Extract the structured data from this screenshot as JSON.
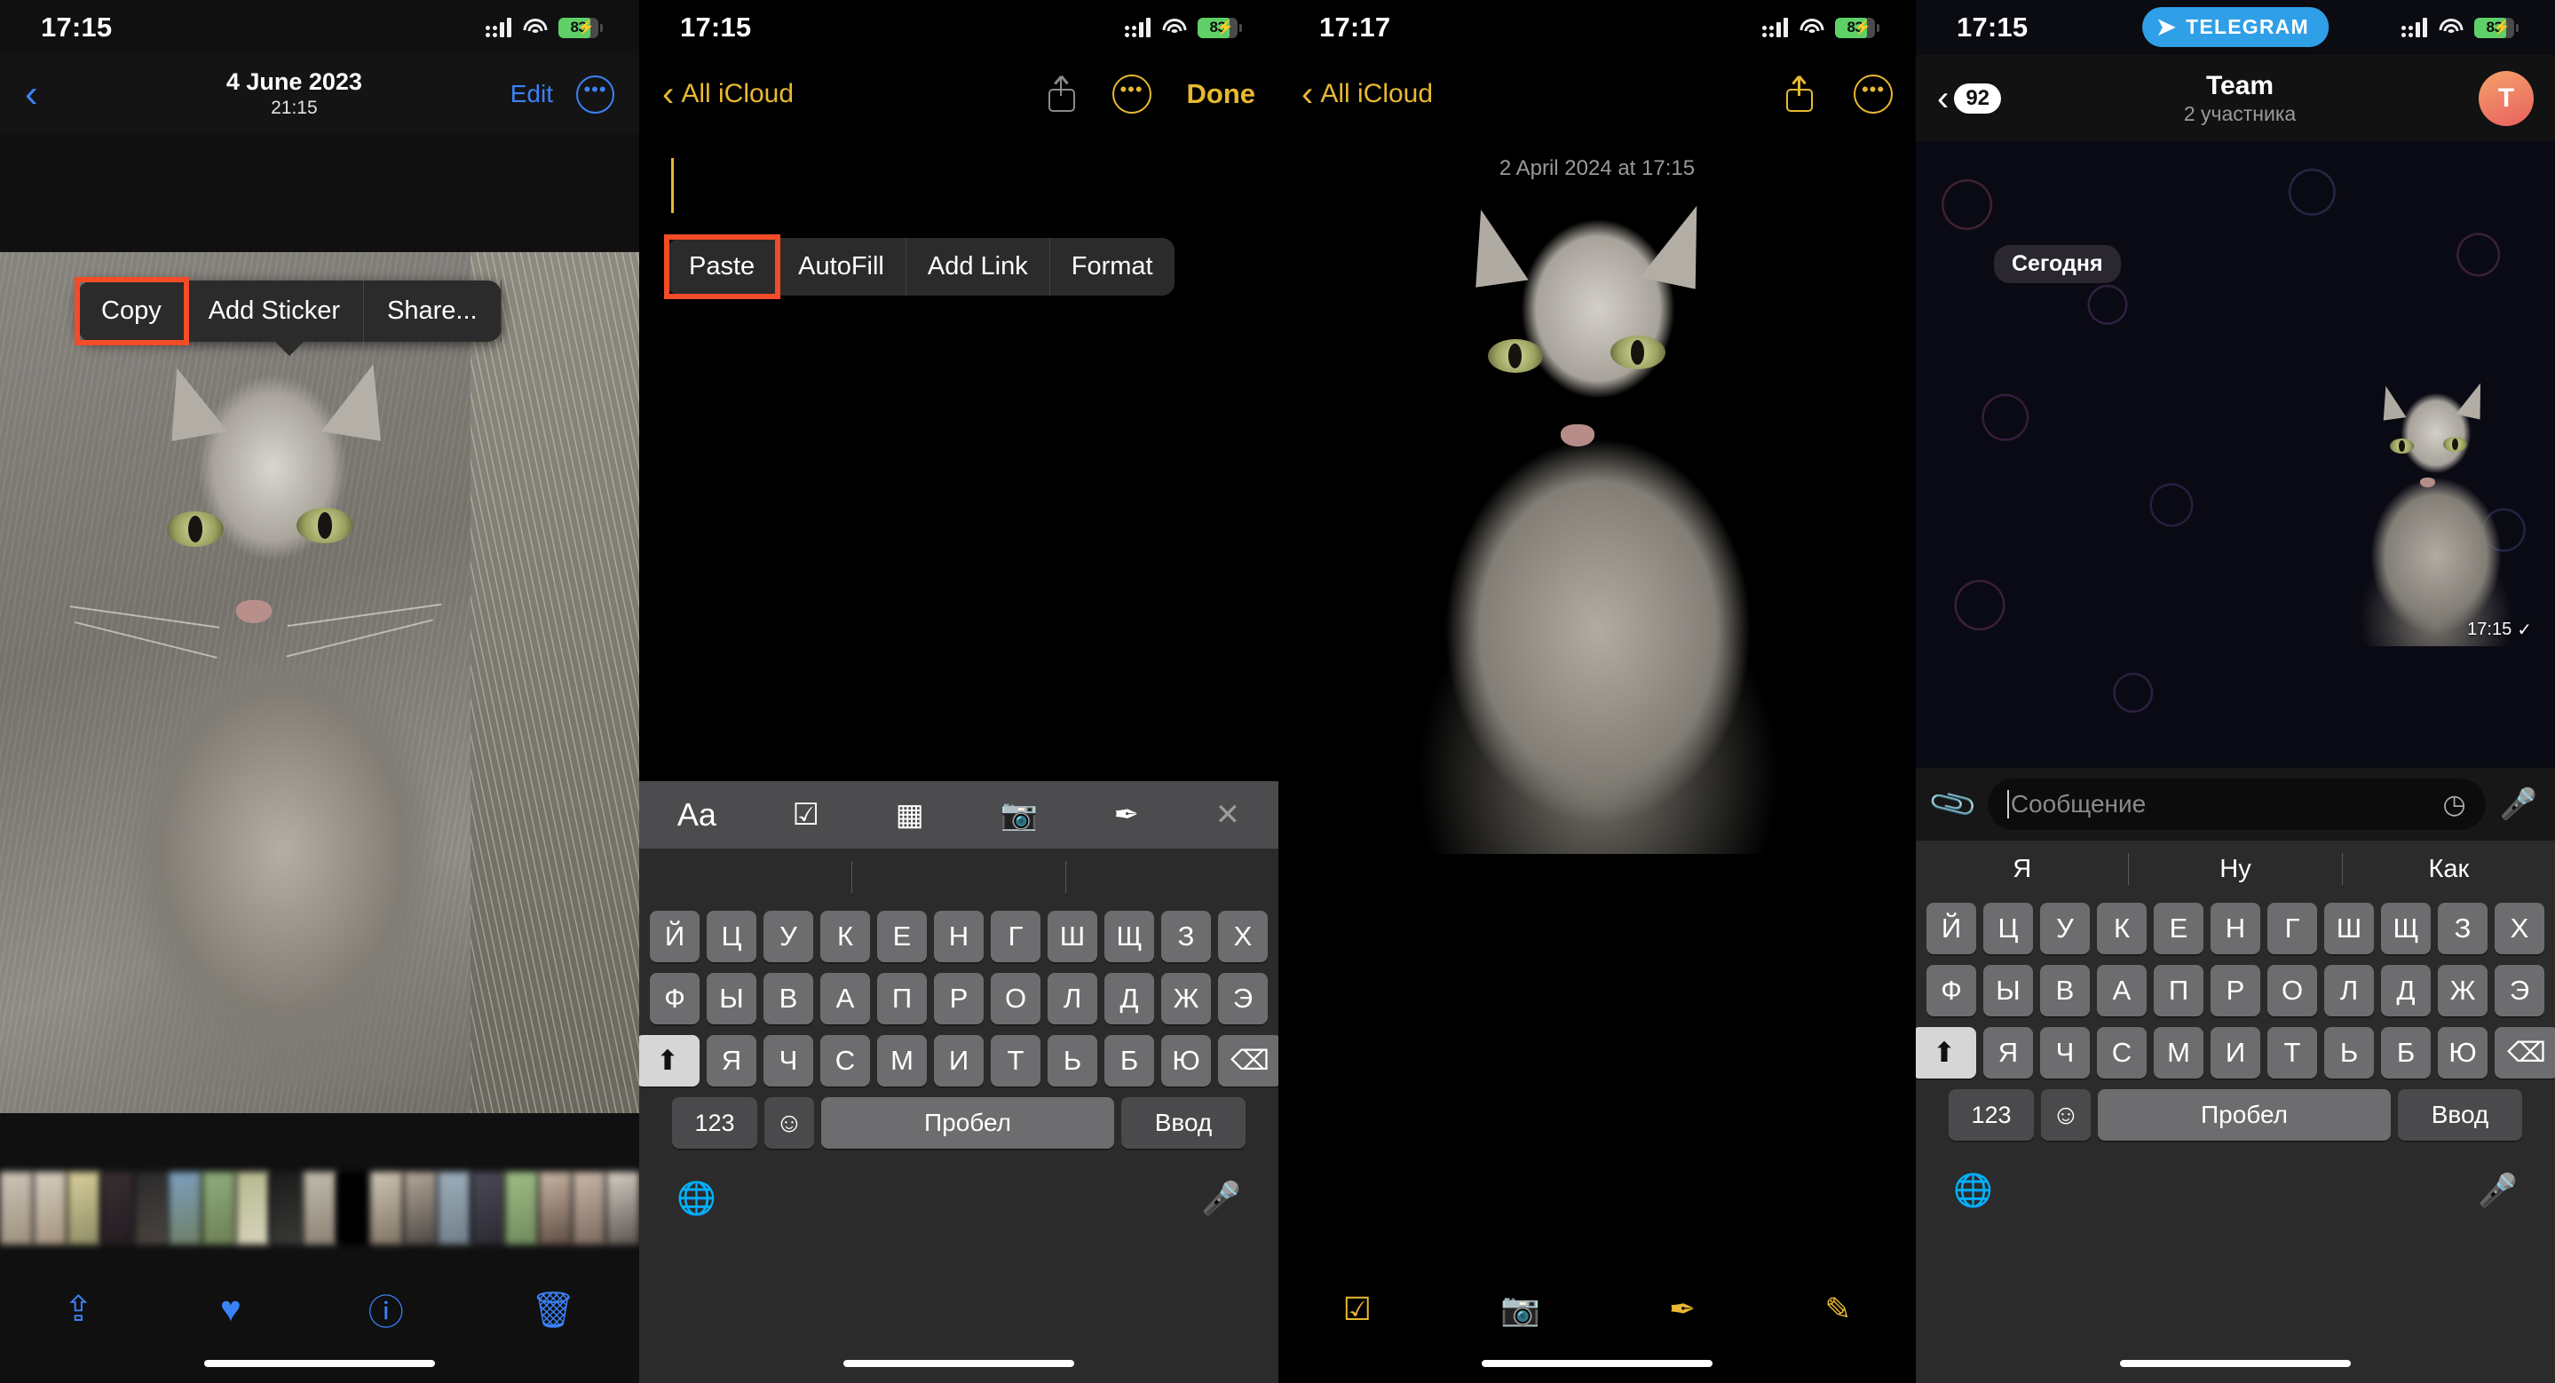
{
  "panel1": {
    "name": "photos-detail",
    "status": {
      "time": "17:15",
      "battery": "83",
      "battery_charging": true
    },
    "nav": {
      "back_icon": "chevron-left-icon",
      "date": "4 June 2023",
      "time": "21:15",
      "edit": "Edit",
      "more_icon": "ellipsis-circle-icon"
    },
    "context_menu": {
      "items": [
        "Copy",
        "Add Sticker",
        "Share..."
      ],
      "highlighted": "Copy"
    },
    "toolbar": [
      "share-icon",
      "heart-icon",
      "info-icon",
      "trash-icon"
    ]
  },
  "panel2": {
    "name": "notes-editor-empty",
    "status": {
      "time": "17:15",
      "battery": "83",
      "battery_charging": true
    },
    "nav": {
      "back_label": "All iCloud",
      "share_icon": "share-icon",
      "more_icon": "ellipsis-circle-icon",
      "done": "Done"
    },
    "context_menu": {
      "items": [
        "Paste",
        "AutoFill",
        "Add Link",
        "Format"
      ],
      "highlighted": "Paste"
    },
    "accessory_bar": [
      "Aa",
      "checklist-icon",
      "table-icon",
      "camera-icon",
      "markup-icon",
      "close-icon"
    ],
    "keyboard": {
      "suggestions": [
        "",
        "",
        ""
      ],
      "row1": [
        "Й",
        "Ц",
        "У",
        "К",
        "Е",
        "Н",
        "Г",
        "Ш",
        "Щ",
        "З",
        "Х"
      ],
      "row2": [
        "Ф",
        "Ы",
        "В",
        "А",
        "П",
        "Р",
        "О",
        "Л",
        "Д",
        "Ж",
        "Э"
      ],
      "row3": [
        "Я",
        "Ч",
        "С",
        "М",
        "И",
        "Т",
        "Ь",
        "Б",
        "Ю"
      ],
      "shift_icon": "shift-icon",
      "backspace_icon": "backspace-icon",
      "numbers": "123",
      "emoji_icon": "emoji-icon",
      "space": "Пробел",
      "enter": "Ввод",
      "globe_icon": "globe-icon",
      "dictation_icon": "microphone-icon"
    }
  },
  "panel3": {
    "name": "notes-with-image",
    "status": {
      "time": "17:17",
      "battery": "83",
      "battery_charging": true
    },
    "nav": {
      "back_label": "All iCloud",
      "share_icon": "share-icon",
      "more_icon": "ellipsis-circle-icon"
    },
    "date_line": "2 April 2024 at 17:15",
    "toolbar": [
      "checklist-icon",
      "camera-icon",
      "markup-icon",
      "compose-icon"
    ]
  },
  "panel4": {
    "name": "telegram-chat",
    "app_badge": {
      "label": "TELEGRAM",
      "icon": "paper-plane-icon",
      "color": "#2f9fe8"
    },
    "status": {
      "time": "17:15",
      "battery": "83",
      "battery_charging": true
    },
    "nav": {
      "back_icon": "chevron-left-icon",
      "unread_count": "92",
      "title": "Team",
      "subtitle": "2 участника",
      "avatar_letter": "T"
    },
    "day_separator": "Сегодня",
    "message": {
      "time": "17:15",
      "status_icon": "check-icon"
    },
    "input": {
      "attach_icon": "paperclip-icon",
      "placeholder": "Сообщение",
      "schedule_icon": "schedule-icon",
      "mic_icon": "microphone-icon"
    },
    "keyboard": {
      "suggestions": [
        "Я",
        "Ну",
        "Как"
      ],
      "row1": [
        "Й",
        "Ц",
        "У",
        "К",
        "Е",
        "Н",
        "Г",
        "Ш",
        "Щ",
        "З",
        "Х"
      ],
      "row2": [
        "Ф",
        "Ы",
        "В",
        "А",
        "П",
        "Р",
        "О",
        "Л",
        "Д",
        "Ж",
        "Э"
      ],
      "row3": [
        "Я",
        "Ч",
        "С",
        "М",
        "И",
        "Т",
        "Ь",
        "Б",
        "Ю"
      ],
      "shift_icon": "shift-icon",
      "backspace_icon": "backspace-icon",
      "numbers": "123",
      "emoji_icon": "emoji-icon",
      "space": "Пробел",
      "enter": "Ввод",
      "globe_icon": "globe-icon",
      "dictation_icon": "microphone-icon"
    }
  }
}
